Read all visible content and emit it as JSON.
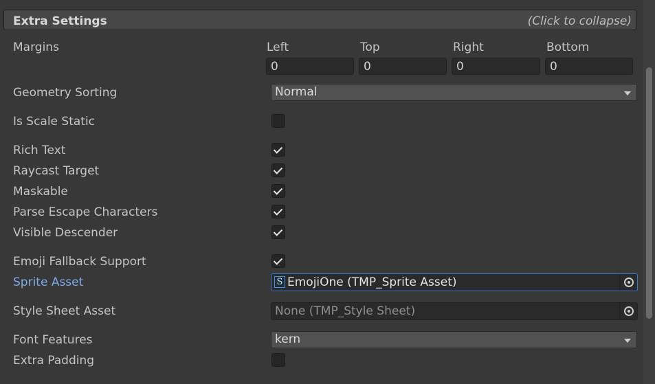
{
  "header": {
    "title": "Extra Settings",
    "hint": "(Click to collapse)"
  },
  "margins": {
    "label": "Margins",
    "fields": [
      {
        "label": "Left",
        "value": "0"
      },
      {
        "label": "Top",
        "value": "0"
      },
      {
        "label": "Right",
        "value": "0"
      },
      {
        "label": "Bottom",
        "value": "0"
      }
    ]
  },
  "geometry_sorting": {
    "label": "Geometry Sorting",
    "value": "Normal"
  },
  "is_scale_static": {
    "label": "Is Scale Static",
    "checked": false
  },
  "rich_text": {
    "label": "Rich Text",
    "checked": true
  },
  "raycast_target": {
    "label": "Raycast Target",
    "checked": true
  },
  "maskable": {
    "label": "Maskable",
    "checked": true
  },
  "parse_escape": {
    "label": "Parse Escape Characters",
    "checked": true
  },
  "visible_descender": {
    "label": "Visible Descender",
    "checked": true
  },
  "emoji_fallback": {
    "label": "Emoji Fallback Support",
    "checked": true
  },
  "sprite_asset": {
    "label": "Sprite Asset",
    "value": "EmojiOne (TMP_Sprite Asset)",
    "icon_letter": "S",
    "icon": "sprite-asset-icon"
  },
  "style_sheet_asset": {
    "label": "Style Sheet Asset",
    "value": "None (TMP_Style Sheet)"
  },
  "font_features": {
    "label": "Font Features",
    "value": "kern"
  },
  "extra_padding": {
    "label": "Extra Padding",
    "checked": false
  },
  "colors": {
    "accent": "#7fa9e6",
    "focus": "#3b79d1",
    "background": "#383838"
  }
}
